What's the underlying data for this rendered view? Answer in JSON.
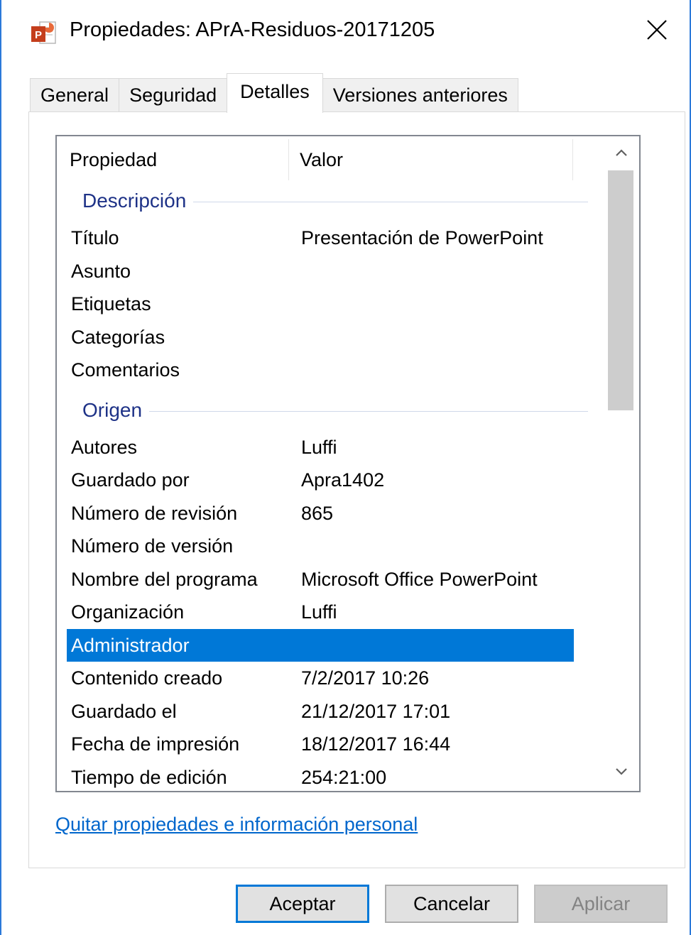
{
  "window": {
    "title": "Propiedades: APrA-Residuos-20171205",
    "app_icon": "powerpoint-file-icon",
    "close_icon": "close-icon"
  },
  "tabs": [
    {
      "label": "General",
      "active": false
    },
    {
      "label": "Seguridad",
      "active": false
    },
    {
      "label": "Detalles",
      "active": true
    },
    {
      "label": "Versiones anteriores",
      "active": false
    }
  ],
  "list": {
    "columns": {
      "property": "Propiedad",
      "value": "Valor"
    },
    "groups": {
      "description": "Descripción",
      "origin": "Origen"
    },
    "rows": {
      "titulo": {
        "name": "Título",
        "value": "Presentación de PowerPoint"
      },
      "asunto": {
        "name": "Asunto",
        "value": ""
      },
      "etiquetas": {
        "name": "Etiquetas",
        "value": ""
      },
      "categorias": {
        "name": "Categorías",
        "value": ""
      },
      "comentarios": {
        "name": "Comentarios",
        "value": ""
      },
      "autores": {
        "name": "Autores",
        "value": "Luffi"
      },
      "guardado_por": {
        "name": "Guardado por",
        "value": "Apra1402"
      },
      "num_revision": {
        "name": "Número de revisión",
        "value": "865"
      },
      "num_version": {
        "name": "Número de versión",
        "value": ""
      },
      "nombre_programa": {
        "name": "Nombre del programa",
        "value": "Microsoft Office PowerPoint"
      },
      "organizacion": {
        "name": "Organización",
        "value": "Luffi"
      },
      "administrador": {
        "name": "Administrador",
        "value": ""
      },
      "contenido_creado": {
        "name": "Contenido creado",
        "value": "7/2/2017 10:26"
      },
      "guardado_el": {
        "name": "Guardado el",
        "value": "21/12/2017 17:01"
      },
      "fecha_impresion": {
        "name": "Fecha de impresión",
        "value": "18/12/2017 16:44"
      },
      "tiempo_edicion": {
        "name": "Tiempo de edición",
        "value": "254:21:00"
      }
    },
    "selected_row": "administrador",
    "scrollbar": {
      "up_icon": "chevron-up-icon",
      "down_icon": "chevron-down-icon"
    }
  },
  "link": {
    "label": "Quitar propiedades e información personal"
  },
  "buttons": {
    "ok": "Aceptar",
    "cancel": "Cancelar",
    "apply": "Aplicar"
  },
  "colors": {
    "accent": "#0078d7",
    "group_text": "#1e3287",
    "link": "#0066cc"
  }
}
